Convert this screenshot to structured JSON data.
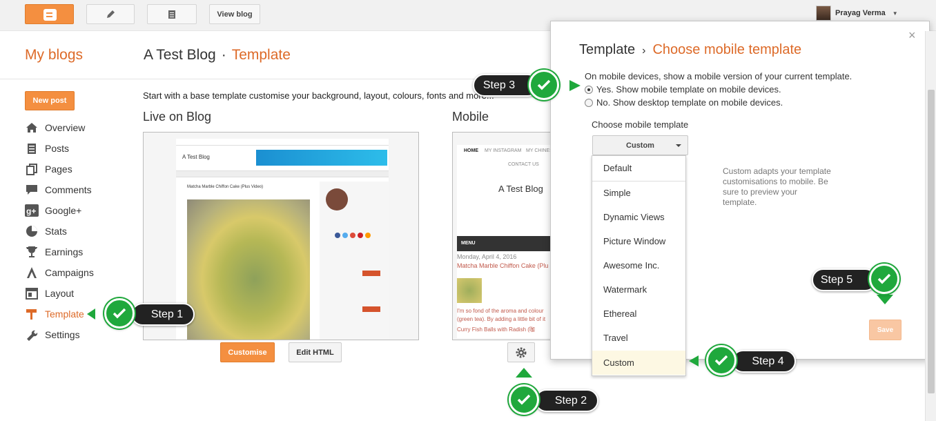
{
  "topbar": {
    "view_blog": "View blog",
    "user_name": "Prayag Verma"
  },
  "header": {
    "my_blogs": "My blogs",
    "blog_name": "A Test Blog",
    "separator": "·",
    "page": "Template"
  },
  "sidebar": {
    "new_post": "New post",
    "items": [
      {
        "label": "Overview",
        "icon": "home-icon"
      },
      {
        "label": "Posts",
        "icon": "posts-icon"
      },
      {
        "label": "Pages",
        "icon": "pages-icon"
      },
      {
        "label": "Comments",
        "icon": "comments-icon"
      },
      {
        "label": "Google+",
        "icon": "google-plus-icon"
      },
      {
        "label": "Stats",
        "icon": "stats-icon"
      },
      {
        "label": "Earnings",
        "icon": "trophy-icon"
      },
      {
        "label": "Campaigns",
        "icon": "campaigns-icon"
      },
      {
        "label": "Layout",
        "icon": "layout-icon"
      },
      {
        "label": "Template",
        "icon": "template-icon",
        "active": true
      },
      {
        "label": "Settings",
        "icon": "wrench-icon"
      }
    ]
  },
  "main": {
    "intro": "Start with a base template customise your background, layout, colours, fonts and more...",
    "live_label": "Live on Blog",
    "mobile_label": "Mobile",
    "customise": "Customise",
    "edit_html": "Edit HTML"
  },
  "live_preview": {
    "blog_title": "A Test Blog",
    "post_title": "Matcha Marble Chiffon Cake (Plus Video)"
  },
  "mobile_preview": {
    "nav": [
      "HOME",
      "MY INSTAGRAM",
      "MY CHINES"
    ],
    "contact": "CONTACT US",
    "blog_title": "A Test Blog",
    "menu": "MENU",
    "date": "Monday, April 4, 2016",
    "post_title": "Matcha Marble Chiffon Cake (Plu",
    "excerpt": "I'm so fond of the aroma and colour (green tea). By adding a little bit of it",
    "post2": "Curry Fish Balls with Radish (咖"
  },
  "dialog": {
    "title": "Template",
    "arrow": "›",
    "subtitle": "Choose mobile template",
    "close": "×",
    "question": "On mobile devices, show a mobile version of your current template.",
    "yes": "Yes. Show mobile template on mobile devices.",
    "no": "No. Show desktop template on mobile devices.",
    "choose_label": "Choose mobile template",
    "selected": "Custom",
    "options": [
      "Default",
      "Simple",
      "Dynamic Views",
      "Picture Window",
      "Awesome Inc.",
      "Watermark",
      "Ethereal",
      "Travel",
      "Custom"
    ],
    "description": "Custom adapts your template customisations to mobile. Be sure to preview your template.",
    "save": "Save"
  },
  "steps": {
    "s1": "Step 1",
    "s2": "Step 2",
    "s3": "Step 3",
    "s4": "Step 4",
    "s5": "Step 5"
  },
  "colors": {
    "accent": "#f48f40",
    "accent_text": "#dd6a28",
    "step_green": "#1fa83c"
  }
}
